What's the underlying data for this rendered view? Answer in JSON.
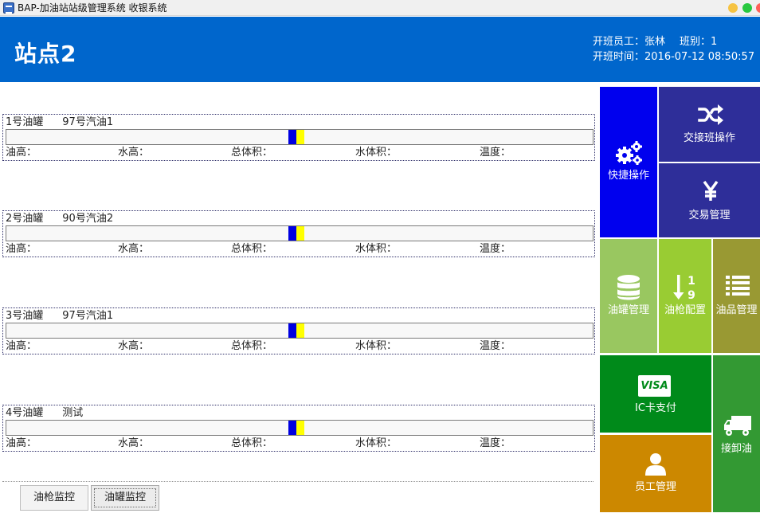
{
  "window": {
    "title": "BAP-加油站站级管理系统 收银系统"
  },
  "header": {
    "station_name": "站点2",
    "shift_staff_label": "开班员工：",
    "shift_staff": "张林",
    "shift_no_label": "班别：",
    "shift_no": "1",
    "shift_time_label": "开班时间：",
    "shift_time": "2016-07-12 08:50:57"
  },
  "tanks": [
    {
      "name": "1号油罐",
      "product": "97号汽油1"
    },
    {
      "name": "2号油罐",
      "product": "90号汽油2"
    },
    {
      "name": "3号油罐",
      "product": "97号汽油1"
    },
    {
      "name": "4号油罐",
      "product": "测试"
    }
  ],
  "reading_labels": {
    "oil_height": "油高：",
    "water_height": "水高：",
    "total_volume": "总体积：",
    "water_volume": "水体积：",
    "temperature": "温度："
  },
  "tabs": {
    "gun_monitor": "油枪监控",
    "tank_monitor": "油罐监控"
  },
  "tiles": {
    "quick_ops": "快捷操作",
    "shift_handover": "交接班操作",
    "trade_mgmt": "交易管理",
    "tank_mgmt": "油罐管理",
    "gun_config": "油枪配置",
    "product_mgmt": "油品管理",
    "ic_card_pay": "IC卡支付",
    "visa_badge": "VISA",
    "staff_mgmt": "员工管理",
    "unload_oil": "接卸油"
  },
  "colors": {
    "header_bg": "#0066cc",
    "oil_level": "#0000e0",
    "water_level": "#ffff00",
    "tile_quick": "#0000ee",
    "tile_navy": "#2e2e99",
    "tile_lightgreen": "#99c760",
    "tile_olive": "#999933",
    "tile_green": "#008a1a",
    "tile_orange": "#cc8800"
  },
  "icons": {
    "quick_ops": "gears-icon",
    "shift_handover": "shuffle-icon",
    "trade_mgmt": "yen-icon",
    "tank_mgmt": "database-icon",
    "gun_config": "sort-numeric-icon",
    "product_mgmt": "list-icon",
    "ic_card_pay": "visa-card-icon",
    "staff_mgmt": "user-icon",
    "unload_oil": "truck-icon"
  }
}
